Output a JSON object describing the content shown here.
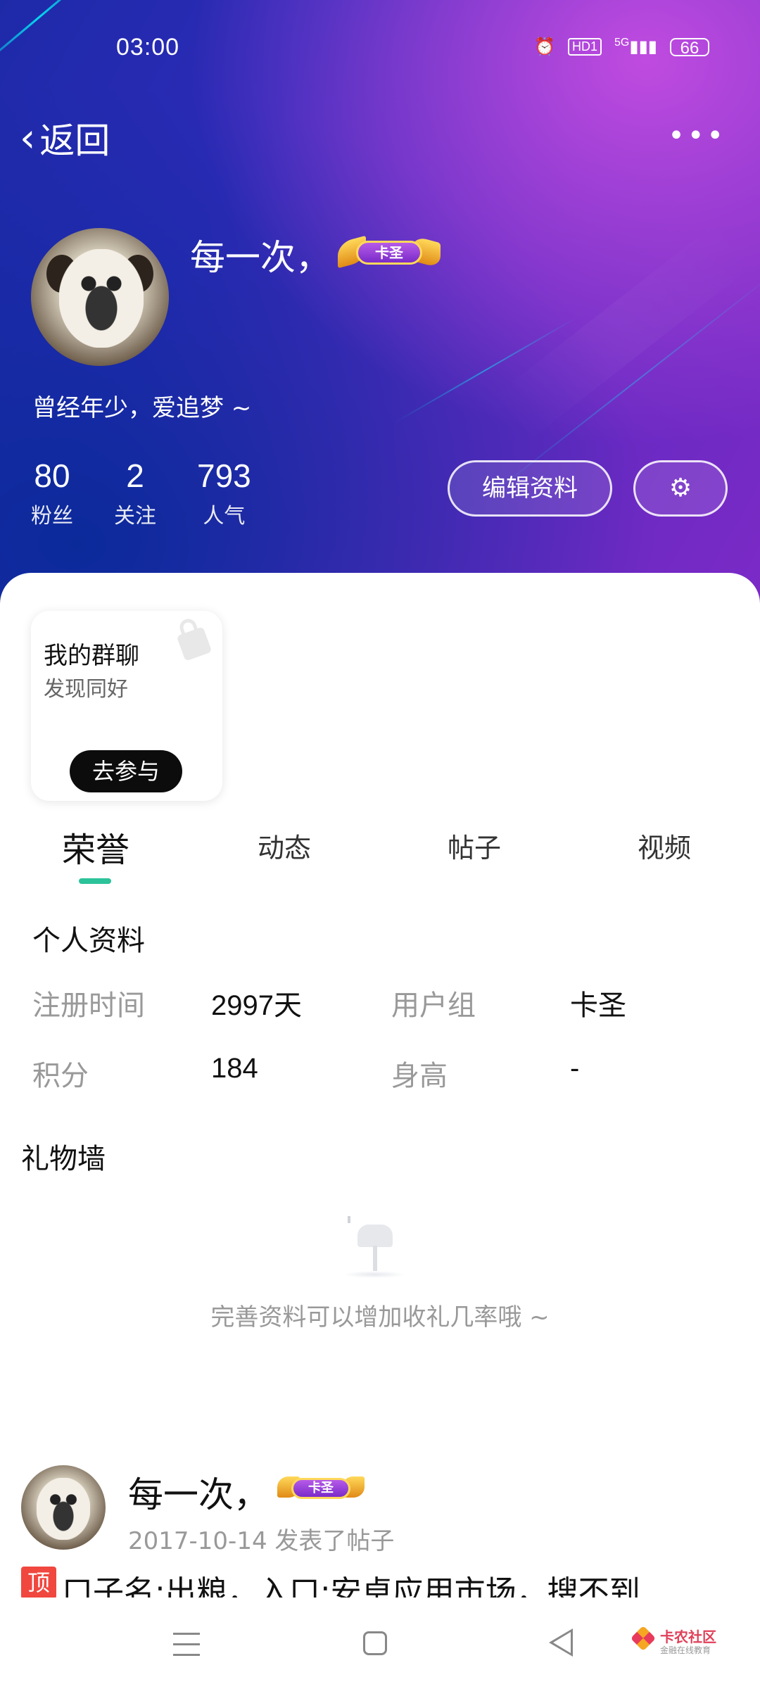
{
  "status_bar": {
    "time": "03:00",
    "hd_label": "HD1",
    "network": "5G",
    "battery": "66"
  },
  "nav": {
    "back_label": "返回",
    "more_label": "•••"
  },
  "profile": {
    "username": "每一次，",
    "badge_text": "卡圣",
    "bio": "曾经年少，爱追梦 ~",
    "stats": [
      {
        "value": "80",
        "label": "粉丝"
      },
      {
        "value": "2",
        "label": "关注"
      },
      {
        "value": "793",
        "label": "人气"
      }
    ],
    "edit_button": "编辑资料",
    "settings_icon": "gear-icon"
  },
  "group_card": {
    "title": "我的群聊",
    "subtitle": "发现同好",
    "join_label": "去参与"
  },
  "tabs": [
    {
      "label": "荣誉",
      "active": true
    },
    {
      "label": "动态",
      "active": false
    },
    {
      "label": "帖子",
      "active": false
    },
    {
      "label": "视频",
      "active": false
    }
  ],
  "personal_info": {
    "title": "个人资料",
    "rows": [
      {
        "label1": "注册时间",
        "value1": "2997天",
        "label2": "用户组",
        "value2": "卡圣"
      },
      {
        "label1": "积分",
        "value1": "184",
        "label2": "身高",
        "value2": "-"
      }
    ]
  },
  "gift_wall": {
    "title": "礼物墙",
    "empty_text": "完善资料可以增加收礼几率哦 ~"
  },
  "post": {
    "author": "每一次，",
    "badge_text": "卡圣",
    "meta": "2017-10-14  发表了帖子",
    "top_tag": "顶",
    "title": "口子名:出粮，入口:安卓应用市场，搜不到"
  },
  "watermark": {
    "name": "卡农社区",
    "sub": "金融在线教育"
  },
  "colors": {
    "accent": "#2cc29a",
    "header_gradient_start": "#1d2aa8",
    "header_gradient_end": "#7c2ac6",
    "top_tag": "#f0473f"
  }
}
